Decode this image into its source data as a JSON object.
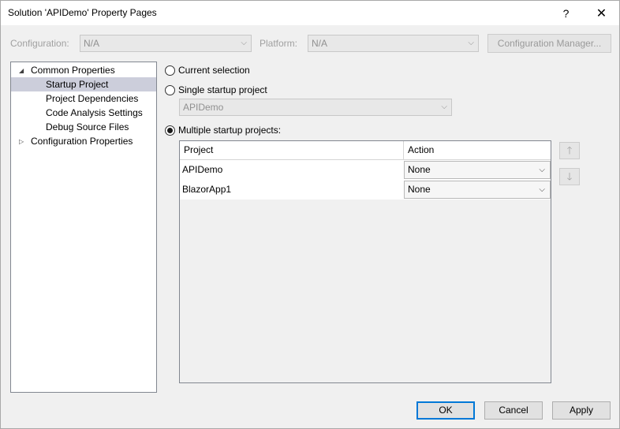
{
  "window": {
    "title": "Solution 'APIDemo' Property Pages",
    "help_glyph": "?",
    "close_glyph": "✕"
  },
  "config_bar": {
    "configuration_label": "Configuration:",
    "configuration_value": "N/A",
    "platform_label": "Platform:",
    "platform_value": "N/A",
    "config_manager_label": "Configuration Manager..."
  },
  "tree": {
    "items": [
      {
        "label": "Common Properties"
      },
      {
        "label": "Startup Project"
      },
      {
        "label": "Project Dependencies"
      },
      {
        "label": "Code Analysis Settings"
      },
      {
        "label": "Debug Source Files"
      },
      {
        "label": "Configuration Properties"
      }
    ]
  },
  "startup": {
    "current_selection_label": "Current selection",
    "single_label": "Single startup project",
    "single_value": "APIDemo",
    "multiple_label": "Multiple startup projects:",
    "selected_option": "multiple"
  },
  "grid": {
    "columns": [
      "Project",
      "Action"
    ],
    "rows": [
      {
        "project": "APIDemo",
        "action": "None"
      },
      {
        "project": "BlazorApp1",
        "action": "None"
      }
    ]
  },
  "move_buttons": {
    "up_glyph": "🡑",
    "down_glyph": "🡓"
  },
  "footer": {
    "ok_label": "OK",
    "cancel_label": "Cancel",
    "apply_label": "Apply"
  },
  "colors": {
    "accent": "#0078d7",
    "tree_selected": "#cccedb"
  }
}
